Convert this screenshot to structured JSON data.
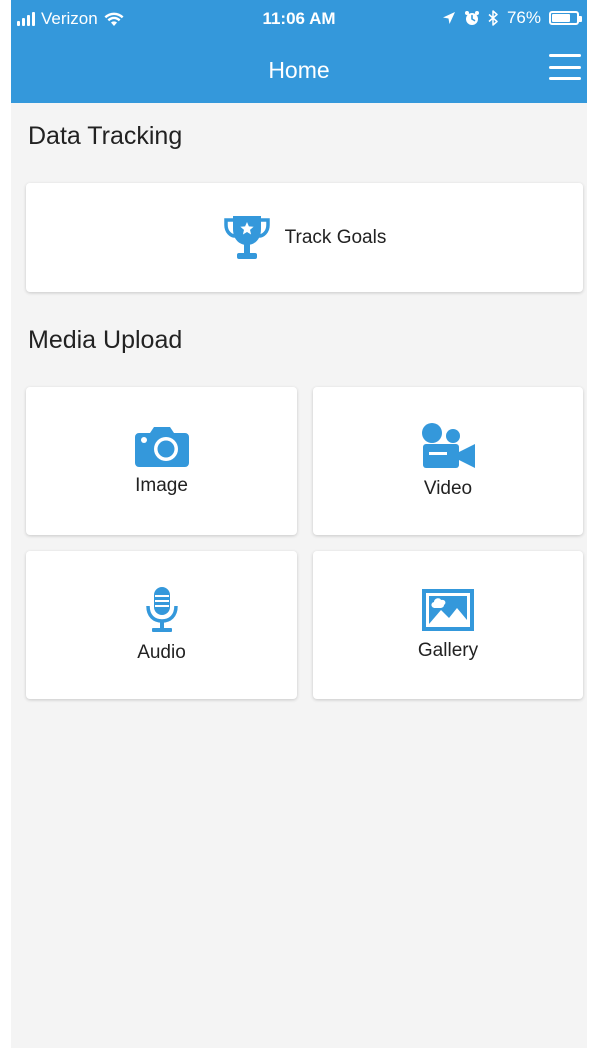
{
  "status_bar": {
    "carrier": "Verizon",
    "time": "11:06 AM",
    "battery_percent": "76%",
    "battery_level": 0.76
  },
  "header": {
    "title": "Home",
    "menu_icon": "hamburger-menu-icon"
  },
  "data_tracking": {
    "title": "Data Tracking",
    "items": [
      {
        "label": "Track Goals",
        "icon": "trophy-icon"
      }
    ]
  },
  "media_upload": {
    "title": "Media Upload",
    "items": [
      {
        "label": "Image",
        "icon": "camera-icon"
      },
      {
        "label": "Video",
        "icon": "video-camera-icon"
      },
      {
        "label": "Audio",
        "icon": "microphone-icon"
      },
      {
        "label": "Gallery",
        "icon": "image-gallery-icon"
      }
    ]
  },
  "colors": {
    "primary": "#3498db",
    "background": "#f4f4f4",
    "card": "#ffffff",
    "text": "#222222"
  }
}
